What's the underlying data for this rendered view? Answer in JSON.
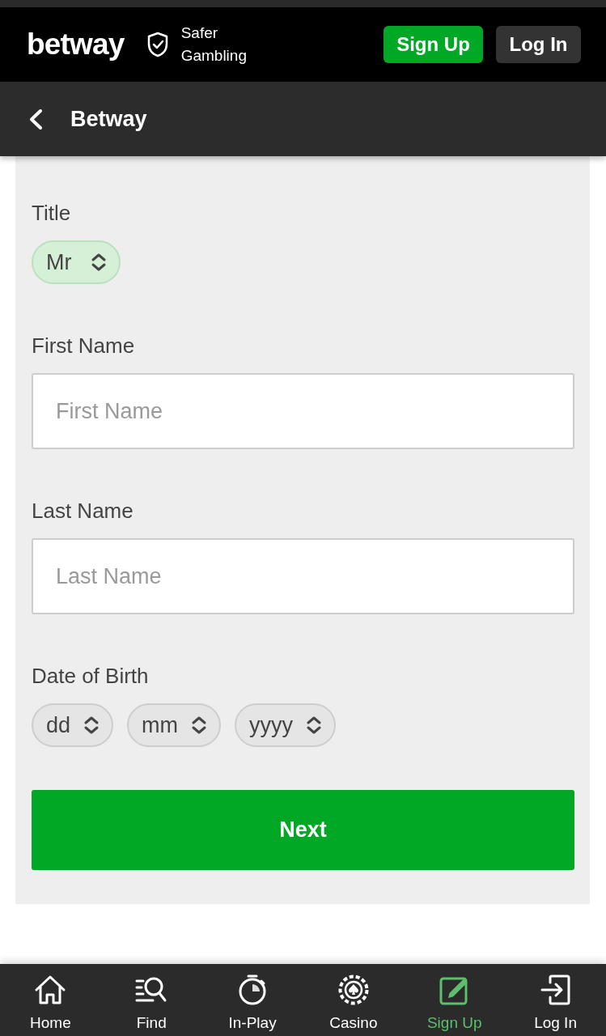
{
  "header": {
    "logo": "betway",
    "safer_gambling": "Safer Gambling",
    "buttons": [
      {
        "label": "Sign Up",
        "kind": "primary"
      },
      {
        "label": "Log In",
        "kind": "secondary"
      }
    ]
  },
  "subheader": {
    "title": "Betway"
  },
  "form": {
    "fields": [
      {
        "kind": "select",
        "label": "Title",
        "selects": [
          {
            "value": "Mr"
          }
        ]
      },
      {
        "kind": "text",
        "label": "First Name",
        "placeholder": "First Name"
      },
      {
        "kind": "text",
        "label": "Last Name",
        "placeholder": "Last Name"
      },
      {
        "kind": "select",
        "label": "Date of Birth",
        "selects": [
          {
            "placeholder": "dd"
          },
          {
            "placeholder": "mm"
          },
          {
            "placeholder": "yyyy"
          }
        ]
      }
    ],
    "submit": "Next"
  },
  "bottom_nav": [
    {
      "label": "Home",
      "selected": false
    },
    {
      "label": "Find",
      "selected": false
    },
    {
      "label": "In-Play",
      "selected": false
    },
    {
      "label": "Casino",
      "selected": false
    },
    {
      "label": "Sign Up",
      "selected": true
    },
    {
      "label": "Log In",
      "selected": false
    }
  ]
}
